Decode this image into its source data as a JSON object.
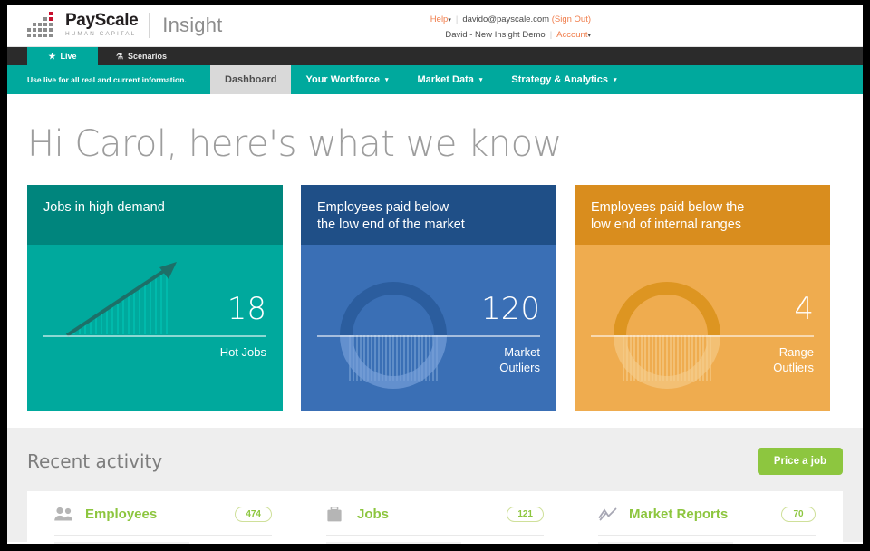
{
  "brand": {
    "name": "PayScale",
    "tagline": "HUMAN CAPITAL",
    "product": "Insight"
  },
  "account": {
    "help_label": "Help",
    "email": "davido@payscale.com",
    "sign_out": "(Sign Out)",
    "user_line": "David - New Insight Demo",
    "account_label": "Account",
    "caret": "▾"
  },
  "tabs": [
    {
      "label": "Live",
      "icon": "star-icon",
      "glyph": "★",
      "active": true
    },
    {
      "label": "Scenarios",
      "icon": "flask-icon",
      "glyph": "⚗",
      "active": false
    }
  ],
  "nav": {
    "note": "Use live for all real and current information.",
    "items": [
      {
        "label": "Dashboard",
        "active": true,
        "caret": ""
      },
      {
        "label": "Your Workforce",
        "active": false,
        "caret": "▾"
      },
      {
        "label": "Market Data",
        "active": false,
        "caret": "▾"
      },
      {
        "label": "Strategy & Analytics",
        "active": false,
        "caret": "▾"
      }
    ]
  },
  "greeting": "Hi Carol, here's what we know",
  "cards": [
    {
      "title": "Jobs in high demand",
      "value": "18",
      "caption": "Hot Jobs",
      "theme": "teal",
      "head_color": "#00857d",
      "body_color": "#00a99d",
      "graphic": "rising-arrow"
    },
    {
      "title": "Employees paid below the low end of the market",
      "title_line1": "Employees paid below",
      "title_line2": "the low end of the market",
      "value": "120",
      "caption_line1": "Market",
      "caption_line2": "Outliers",
      "theme": "blue",
      "head_color": "#1f4f87",
      "body_color": "#3a6fb5",
      "graphic": "donut-ring"
    },
    {
      "title": "Employees paid below the low end of internal ranges",
      "title_line1": "Employees paid below the",
      "title_line2": "low end of internal ranges",
      "value": "4",
      "caption_line1": "Range",
      "caption_line2": "Outliers",
      "theme": "orange",
      "head_color": "#d98d1e",
      "body_color": "#efac4f",
      "graphic": "donut-ring"
    }
  ],
  "activity": {
    "title": "Recent activity",
    "price_button": "Price a job",
    "columns": [
      {
        "label": "Employees",
        "count": "474",
        "icon": "people-icon"
      },
      {
        "label": "Jobs",
        "count": "121",
        "icon": "briefcase-icon"
      },
      {
        "label": "Market Reports",
        "count": "70",
        "icon": "line-chart-icon"
      }
    ]
  },
  "colors": {
    "teal": "#00a99d",
    "teal_dark": "#00857d",
    "blue": "#3a6fb5",
    "blue_dark": "#1f4f87",
    "orange": "#efac4f",
    "orange_dark": "#d98d1e",
    "green": "#8dc63f",
    "link_orange": "#f07d4b"
  }
}
